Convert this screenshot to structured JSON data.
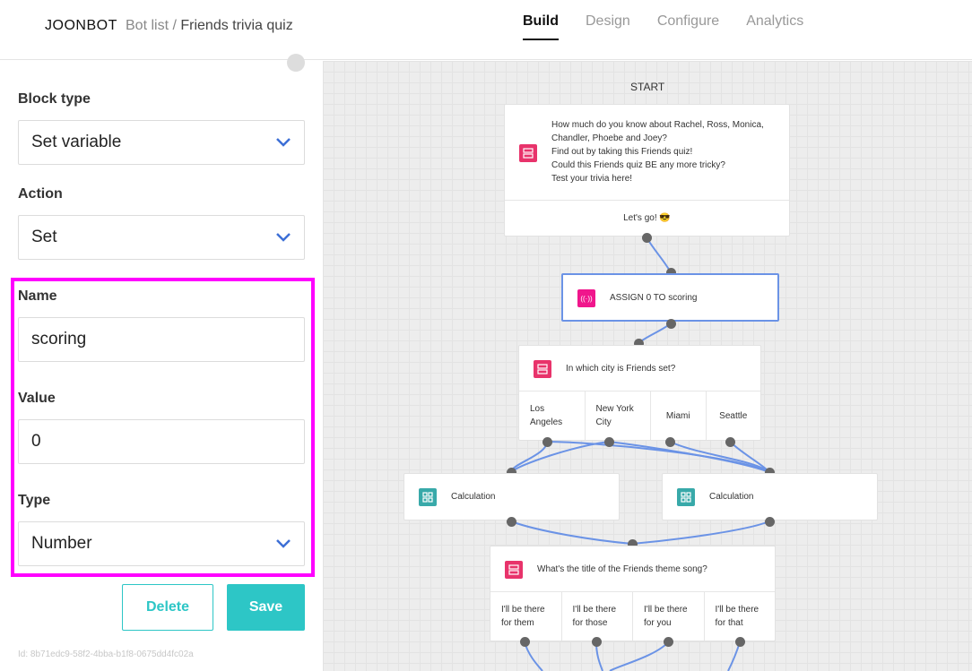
{
  "header": {
    "logo": "JOONBOT",
    "breadcrumb_parent": "Bot list",
    "breadcrumb_sep": " / ",
    "breadcrumb_current": "Friends trivia quiz",
    "tabs": [
      "Build",
      "Design",
      "Configure",
      "Analytics"
    ]
  },
  "sidebar": {
    "block_type_label": "Block type",
    "block_type_value": "Set variable",
    "action_label": "Action",
    "action_value": "Set",
    "name_label": "Name",
    "name_value": "scoring",
    "value_label": "Value",
    "value_value": "0",
    "type_label": "Type",
    "type_value": "Number",
    "delete_label": "Delete",
    "save_label": "Save",
    "block_id": "Id: 8b71edc9-58f2-4bba-b1f8-0675dd4fc02a"
  },
  "canvas": {
    "start_label": "START",
    "intro": {
      "lines": [
        "How much do you know about Rachel, Ross, Monica,",
        "Chandler, Phoebe and Joey?",
        "Find out by taking this Friends quiz!",
        "Could this Friends quiz BE any more tricky?",
        "Test your trivia here!"
      ],
      "button": "Let's go! 😎"
    },
    "assign": {
      "text": "ASSIGN 0 TO scoring",
      "icon": "((·))"
    },
    "question1": {
      "text": "In which city is Friends set?",
      "choices": [
        "Los Angeles",
        "New York City",
        "Miami",
        "Seattle"
      ]
    },
    "calc_left": {
      "text": "Calculation"
    },
    "calc_right": {
      "text": "Calculation"
    },
    "question2": {
      "text": "What's the title of the Friends theme song?",
      "choices": [
        "I'll be there for them",
        "I'll be there for those",
        "I'll be there for you",
        "I'll be there for that"
      ]
    }
  },
  "colors": {
    "accent": "#2dc6c6",
    "highlight": "#ff00ff",
    "wire": "#6b93e6",
    "message_icon": "#e8336b",
    "variable_icon": "#f0168c",
    "calc_icon": "#38a9a9"
  }
}
